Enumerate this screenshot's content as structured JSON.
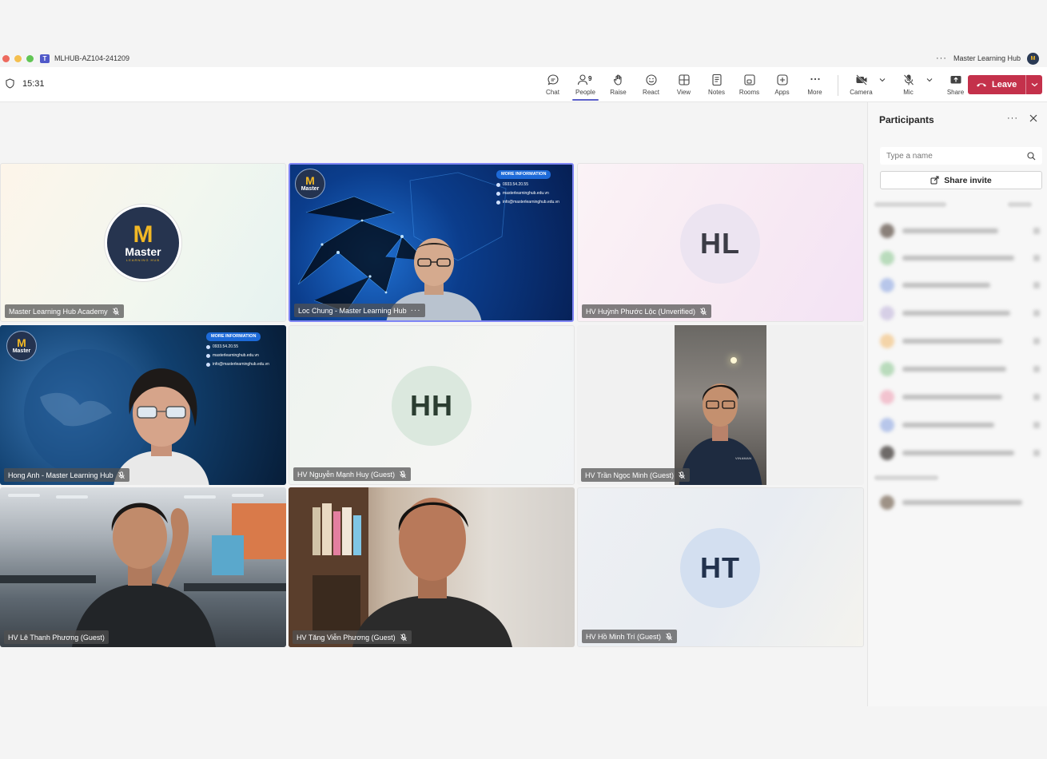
{
  "window": {
    "title": "MLHUB-AZ104-241209",
    "org_name": "Master Learning Hub"
  },
  "meeting": {
    "elapsed": "15:31"
  },
  "toolbar": {
    "items": [
      {
        "label": "Chat",
        "icon": "chat-icon"
      },
      {
        "label": "People",
        "icon": "people-icon",
        "badge": "9",
        "active": true
      },
      {
        "label": "Raise",
        "icon": "hand-icon"
      },
      {
        "label": "React",
        "icon": "smiley-icon"
      },
      {
        "label": "View",
        "icon": "grid-icon"
      },
      {
        "label": "Notes",
        "icon": "notes-icon"
      },
      {
        "label": "Rooms",
        "icon": "rooms-icon"
      },
      {
        "label": "Apps",
        "icon": "plus-square-icon"
      },
      {
        "label": "More",
        "icon": "ellipsis-icon"
      }
    ],
    "camera_label": "Camera",
    "mic_label": "Mic",
    "share_label": "Share",
    "leave_label": "Leave",
    "colors": {
      "accent": "#5b5fc7",
      "leave": "#c4314b"
    }
  },
  "tiles": [
    {
      "name": "Master Learning Hub Academy",
      "kind": "logo",
      "muted": true
    },
    {
      "name": "Loc Chung - Master Learning Hub",
      "kind": "video",
      "active_speaker": true
    },
    {
      "name": "HV Huỳnh Phước Lộc (Unverified)",
      "kind": "initials",
      "initials": "HL",
      "muted": true
    },
    {
      "name": "Hong Anh - Master Learning Hub",
      "kind": "video",
      "muted": true
    },
    {
      "name": "HV Nguyễn Mạnh Huy (Guest)",
      "kind": "initials",
      "initials": "HH",
      "muted": true
    },
    {
      "name": "HV Trần Ngọc Minh (Guest)",
      "kind": "video",
      "muted": true
    },
    {
      "name": "HV Lê Thanh Phương (Guest)",
      "kind": "video"
    },
    {
      "name": "HV Tăng Viễn Phương (Guest)",
      "kind": "video",
      "muted": true
    },
    {
      "name": "HV Hồ Minh Trí (Guest)",
      "kind": "initials",
      "initials": "HT",
      "muted": true
    }
  ],
  "brand": {
    "logo_letter": "M",
    "logo_word": "Master",
    "logo_sub": "LEARNING HUB"
  },
  "background_info": {
    "heading": "MORE INFORMATION",
    "phone": "0933.54.20.55",
    "website": "masterlearninghub.edu.vn",
    "email": "info@masterlearninghub.edu.vn"
  },
  "shirt_text": "VINAMAN",
  "participants_panel": {
    "title": "Participants",
    "search_placeholder": "Type a name",
    "share_invite_label": "Share invite"
  }
}
